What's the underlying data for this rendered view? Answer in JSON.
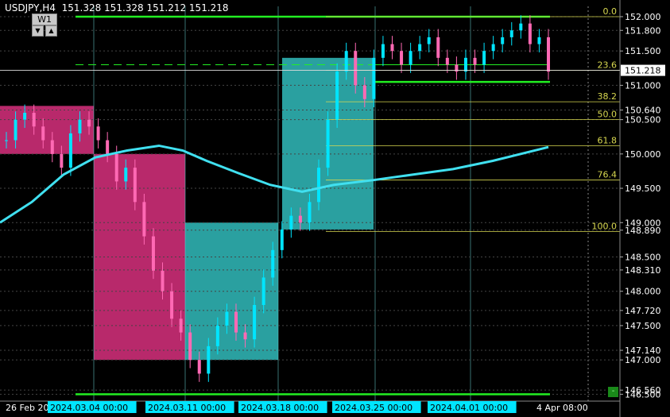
{
  "header": {
    "symbol": "USDJPY,H4",
    "ohlc": "151.328 151.328 151.212 151.218",
    "period_button": "W1"
  },
  "colors": {
    "background": "#000000",
    "bull_candle": "#00e5ff",
    "bear_candle": "#ff69b4",
    "ma_line": "#40e0f0",
    "fib_line": "#d8d850",
    "green_line": "#22ee22",
    "bull_box": "#2aa0a0",
    "bear_box": "#b8296b",
    "text": "#ffffff"
  },
  "chart_data": {
    "type": "candlestick",
    "title": "USDJPY,H4",
    "ylim": [
      146.4,
      152.15
    ],
    "price_ticks": [
      "152.000",
      "151.800",
      "151.500",
      "151.000",
      "150.640",
      "150.500",
      "150.000",
      "149.500",
      "149.000",
      "148.890",
      "148.500",
      "148.310",
      "148.000",
      "147.720",
      "147.500",
      "147.140",
      "147.000",
      "146.560",
      "146.500"
    ],
    "current_price": "151.218",
    "time_labels": [
      "26 Feb 20",
      "2024.03.04 00:00",
      "2024.03.11 00:00",
      "2024.03.18 00:00",
      "2024.03.25 00:00",
      "2024.04.01 00:00",
      "4 Apr 08:00"
    ],
    "fib_levels": [
      {
        "label": "0.0",
        "price": 152.0
      },
      {
        "label": "23.6",
        "price": 151.218
      },
      {
        "label": "38.2",
        "price": 150.76
      },
      {
        "label": "50.0",
        "price": 150.5
      },
      {
        "label": "61.8",
        "price": 150.12
      },
      {
        "label": "76.4",
        "price": 149.62
      },
      {
        "label": "100.0",
        "price": 148.87
      }
    ],
    "green_levels": [
      152.0,
      146.5
    ],
    "range_levels": [
      151.7,
      151.3,
      151.05
    ],
    "ma_points": [
      [
        0,
        149.0
      ],
      [
        40,
        149.3
      ],
      [
        80,
        149.7
      ],
      [
        120,
        149.95
      ],
      [
        160,
        150.05
      ],
      [
        200,
        150.12
      ],
      [
        230,
        150.05
      ],
      [
        260,
        149.9
      ],
      [
        300,
        149.72
      ],
      [
        340,
        149.55
      ],
      [
        380,
        149.45
      ],
      [
        420,
        149.55
      ],
      [
        470,
        149.62
      ],
      [
        520,
        149.7
      ],
      [
        570,
        149.78
      ],
      [
        620,
        149.9
      ],
      [
        690,
        150.1
      ]
    ],
    "candles_close": [
      150.2,
      150.5,
      150.6,
      150.4,
      150.2,
      150.0,
      149.8,
      150.3,
      150.5,
      150.4,
      150.2,
      150.0,
      149.6,
      149.8,
      149.3,
      148.8,
      148.3,
      148.0,
      147.6,
      147.4,
      147.0,
      146.8,
      147.2,
      147.5,
      147.7,
      147.4,
      147.3,
      147.8,
      148.2,
      148.6,
      148.9,
      149.1,
      149.0,
      149.3,
      149.8,
      150.5,
      151.2,
      151.5,
      151.0,
      150.8,
      151.4,
      151.6,
      151.5,
      151.3,
      151.5,
      151.6,
      151.7,
      151.4,
      151.3,
      151.2,
      151.4,
      151.3,
      151.5,
      151.6,
      151.7,
      151.8,
      151.9,
      151.6,
      151.7,
      151.2
    ]
  }
}
